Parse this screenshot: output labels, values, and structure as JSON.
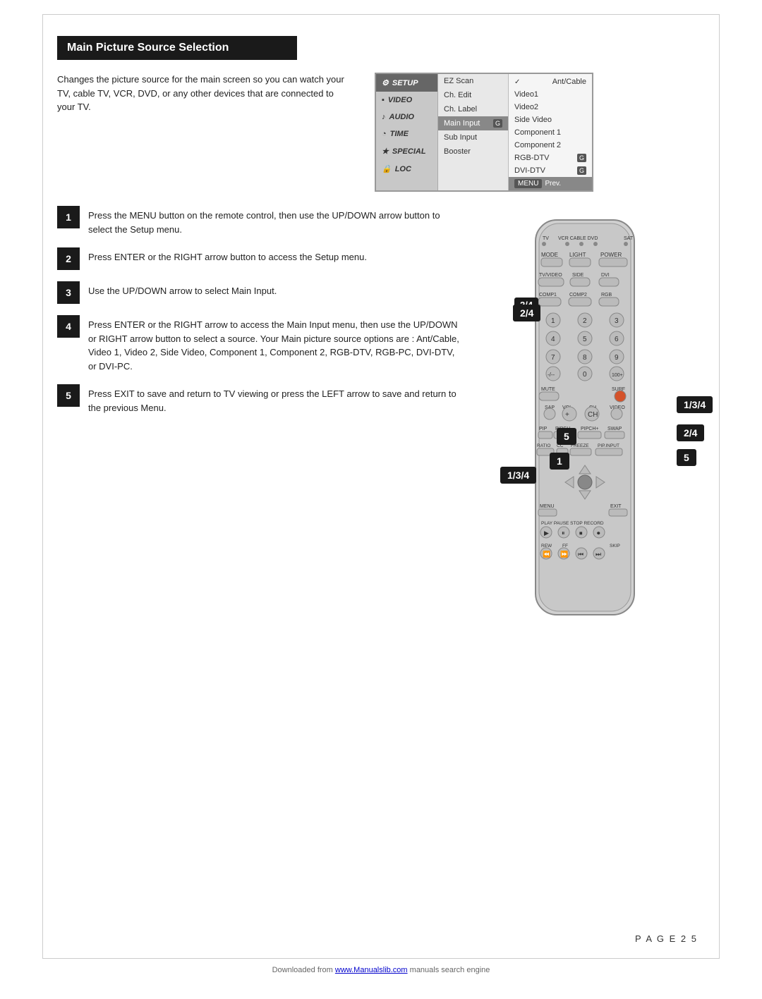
{
  "page": {
    "title": "Main Picture Source Selection",
    "page_number": "P A G E  2 5"
  },
  "intro": {
    "text": "Changes the picture source for the main screen so you can watch your TV, cable TV, VCR, DVD, or any other devices that are connected to your TV."
  },
  "menu": {
    "col1": [
      {
        "label": "SETUP",
        "selected": true,
        "icon": "wrench"
      },
      {
        "label": "VIDEO",
        "selected": false,
        "icon": "square"
      },
      {
        "label": "AUDIO",
        "selected": false,
        "icon": "note"
      },
      {
        "label": "TIME",
        "selected": false,
        "icon": "clock"
      },
      {
        "label": "SPECIAL",
        "selected": false,
        "icon": "special"
      },
      {
        "label": "LOC",
        "selected": false,
        "icon": "lock"
      }
    ],
    "col2": [
      {
        "label": "EZ Scan",
        "selected": false,
        "badge": ""
      },
      {
        "label": "Ch. Edit",
        "selected": false,
        "badge": ""
      },
      {
        "label": "Ch. Label",
        "selected": false,
        "badge": ""
      },
      {
        "label": "Main Input",
        "selected": true,
        "badge": "G"
      },
      {
        "label": "Sub Input",
        "selected": false,
        "badge": ""
      },
      {
        "label": "Booster",
        "selected": false,
        "badge": ""
      }
    ],
    "col3": [
      {
        "label": "Ant/Cable",
        "checked": true,
        "badge": ""
      },
      {
        "label": "Video1",
        "checked": false,
        "badge": ""
      },
      {
        "label": "Video2",
        "checked": false,
        "badge": ""
      },
      {
        "label": "Side Video",
        "checked": false,
        "badge": ""
      },
      {
        "label": "Component 1",
        "checked": false,
        "badge": ""
      },
      {
        "label": "Component 2",
        "checked": false,
        "badge": ""
      },
      {
        "label": "RGB-DTV",
        "checked": false,
        "badge": "G"
      },
      {
        "label": "DVI-DTV",
        "checked": false,
        "badge": "G"
      }
    ],
    "footer": {
      "menu_label": "MENU",
      "prev_label": "Prev."
    }
  },
  "steps": [
    {
      "number": "1",
      "text": "Press the MENU button on the remote control, then use the UP/DOWN arrow button to select the Setup menu."
    },
    {
      "number": "2",
      "text": "Press ENTER or the RIGHT arrow button to access the Setup menu."
    },
    {
      "number": "3",
      "text": "Use the UP/DOWN arrow to select Main Input."
    },
    {
      "number": "4",
      "text": "Press ENTER or the RIGHT arrow to access the Main Input menu, then use the UP/DOWN or RIGHT arrow button to select a source. Your Main picture source options are : Ant/Cable, Video 1, Video 2, Side Video, Component 1, Component 2, RGB-DTV, RGB-PC, DVI-DTV, or DVI-PC."
    },
    {
      "number": "5",
      "text": "Press EXIT to save and return to TV viewing or press the LEFT arrow to save and return to the previous Menu."
    }
  ],
  "callouts": {
    "top_left": "2/4",
    "bottom_left": "1/3/4",
    "top_right": "1/3/4",
    "mid_right": "2/4",
    "bot_right": "5",
    "center_5": "5",
    "center_1": "1"
  },
  "footer": {
    "download_text": "Downloaded from ",
    "download_link": "www.Manualslib.com",
    "download_suffix": " manuals search engine"
  }
}
